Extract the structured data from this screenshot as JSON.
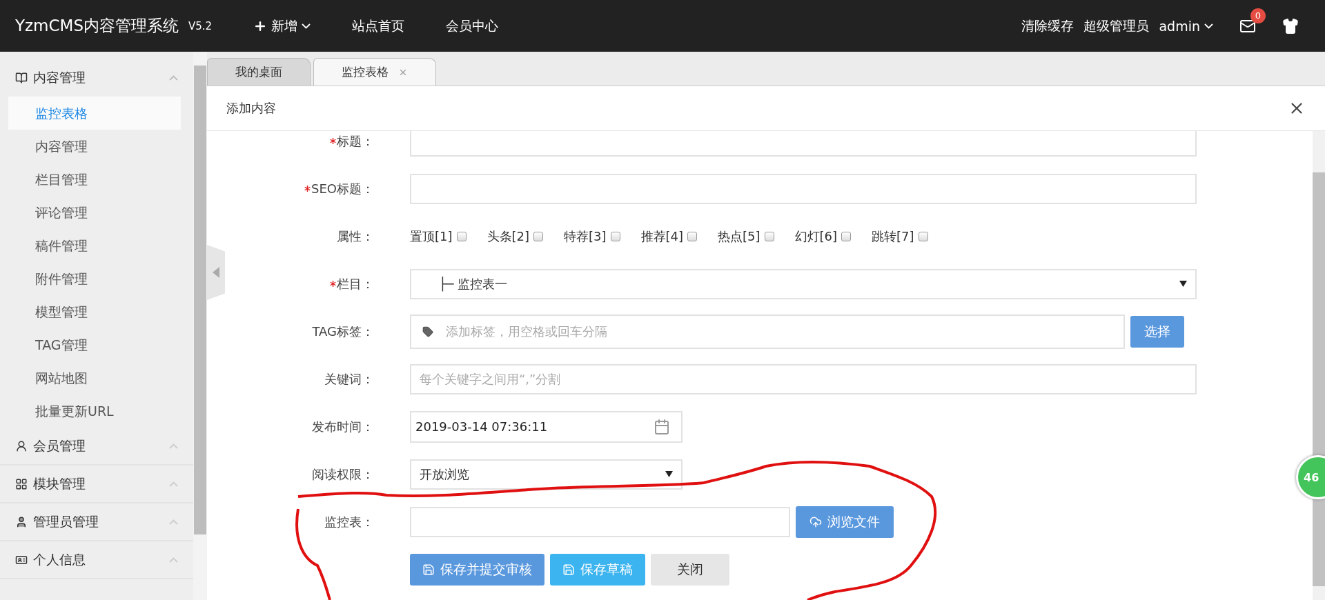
{
  "topbar": {
    "logo": "YzmCMS内容管理系统",
    "version": "V5.2",
    "nav": [
      {
        "kind": "add",
        "label": "新增"
      },
      {
        "kind": "link",
        "label": "站点首页"
      },
      {
        "kind": "link",
        "label": "会员中心"
      }
    ],
    "actions": [
      "清除缓存",
      "超级管理员"
    ],
    "user": "admin",
    "mail_badge": "0"
  },
  "sidebar": {
    "groups": [
      {
        "kind": "book",
        "label": "内容管理",
        "expanded": true,
        "items": [
          {
            "label": "监控表格",
            "selected": true
          },
          {
            "label": "内容管理",
            "selected": false
          },
          {
            "label": "栏目管理",
            "selected": false
          },
          {
            "label": "评论管理",
            "selected": false
          },
          {
            "label": "稿件管理",
            "selected": false
          },
          {
            "label": "附件管理",
            "selected": false
          },
          {
            "label": "模型管理",
            "selected": false
          },
          {
            "label": "TAG管理",
            "selected": false
          },
          {
            "label": "网站地图",
            "selected": false
          },
          {
            "label": "批量更新URL",
            "selected": false
          }
        ]
      },
      {
        "kind": "user",
        "label": "会员管理",
        "expanded": false
      },
      {
        "kind": "grid",
        "label": "模块管理",
        "expanded": false
      },
      {
        "kind": "admin",
        "label": "管理员管理",
        "expanded": false
      },
      {
        "kind": "card",
        "label": "个人信息",
        "expanded": false
      }
    ]
  },
  "tabs": [
    {
      "label": "我的桌面",
      "selected": false,
      "closable": false
    },
    {
      "label": "监控表格",
      "selected": true,
      "closable": true
    }
  ],
  "panel": {
    "title": "添加内容"
  },
  "form": {
    "rows": [
      {
        "kind": "text",
        "label": "标题：",
        "required": true
      },
      {
        "kind": "text",
        "label": "SEO标题：",
        "required": true
      },
      {
        "kind": "checkboxes",
        "label": "属性：",
        "required": false,
        "options": [
          {
            "label": "置顶[1]",
            "checked": false
          },
          {
            "label": "头条[2]",
            "checked": false
          },
          {
            "label": "特荐[3]",
            "checked": false
          },
          {
            "label": "推荐[4]",
            "checked": false
          },
          {
            "label": "热点[5]",
            "checked": false
          },
          {
            "label": "幻灯[6]",
            "checked": false
          },
          {
            "label": "跳转[7]",
            "checked": false
          }
        ]
      },
      {
        "kind": "tree_select",
        "label": "栏目：",
        "required": true,
        "value": "├─ 监控表一"
      },
      {
        "kind": "tags",
        "label": "TAG标签：",
        "required": false,
        "placeholder": "添加标签，用空格或回车分隔",
        "button": "选择"
      },
      {
        "kind": "text",
        "label": "关键词：",
        "required": false,
        "placeholder": "每个关键字之间用“,”分割"
      },
      {
        "kind": "date",
        "label": "发布时间：",
        "required": false,
        "value": "2019-03-14 07:36:11"
      },
      {
        "kind": "select",
        "label": "阅读权限：",
        "required": false,
        "value": "开放浏览"
      },
      {
        "kind": "file",
        "label": "监控表：",
        "required": false,
        "button": "浏览文件"
      }
    ],
    "buttons": [
      {
        "kind": "primary",
        "label": "保存并提交审核"
      },
      {
        "kind": "info",
        "label": "保存草稿"
      },
      {
        "kind": "plain",
        "label": "关闭"
      }
    ]
  },
  "float_badge": "46"
}
